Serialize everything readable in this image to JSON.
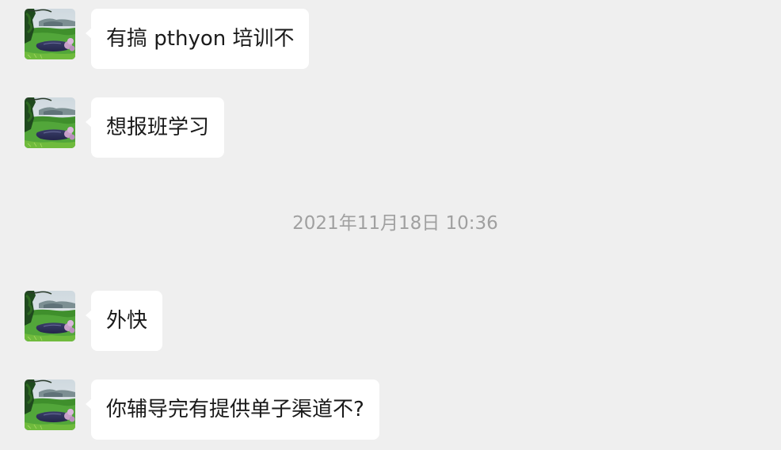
{
  "messages": [
    {
      "text": "有搞 pthyon 培训不"
    },
    {
      "text": "想报班学习"
    },
    {
      "text": "外快"
    },
    {
      "text": "你辅导完有提供单子渠道不?"
    }
  ],
  "timestamp": "2021年11月18日 10:36",
  "colors": {
    "background": "#efefef",
    "bubble": "#ffffff",
    "text": "#1a1a1a",
    "timestamp": "#a0a0a0"
  },
  "avatar_icon": "landscape-avatar-icon"
}
